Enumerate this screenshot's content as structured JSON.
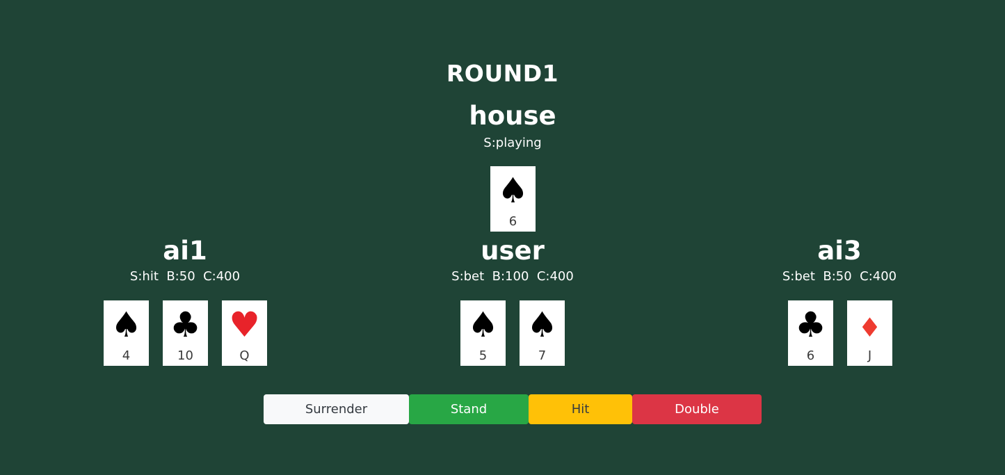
{
  "round": {
    "title": "ROUND1"
  },
  "house": {
    "name": "house",
    "status": "S:playing",
    "cards": [
      {
        "suit": "spade-icon",
        "glyph": "♠",
        "color": "#000000",
        "rank": "6"
      }
    ]
  },
  "players": {
    "ai1": {
      "name": "ai1",
      "stats": "S:hit  B:50  C:400",
      "cards": [
        {
          "suit": "spade-icon",
          "glyph": "♠",
          "color": "#000000",
          "rank": "4"
        },
        {
          "suit": "club-icon",
          "glyph": "♣",
          "color": "#000000",
          "rank": "10"
        },
        {
          "suit": "heart-icon",
          "glyph": "♥",
          "color": "#e8232a",
          "rank": "Q"
        }
      ]
    },
    "user": {
      "name": "user",
      "stats": "S:bet  B:100  C:400",
      "cards": [
        {
          "suit": "spade-icon",
          "glyph": "♠",
          "color": "#000000",
          "rank": "5"
        },
        {
          "suit": "spade-icon",
          "glyph": "♠",
          "color": "#000000",
          "rank": "7"
        }
      ]
    },
    "ai3": {
      "name": "ai3",
      "stats": "S:bet  B:50  C:400",
      "cards": [
        {
          "suit": "club-icon",
          "glyph": "♣",
          "color": "#000000",
          "rank": "6"
        },
        {
          "suit": "diamond-icon",
          "glyph": "♦",
          "color": "#ee3b30",
          "rank": "J"
        }
      ]
    }
  },
  "actions": {
    "surrender_label": "Surrender",
    "stand_label": "Stand",
    "hit_label": "Hit",
    "double_label": "Double"
  },
  "colors": {
    "table": "#1f4436",
    "surrender": "#f8f9fa",
    "stand": "#28a745",
    "hit": "#ffc107",
    "double": "#dc3545"
  }
}
